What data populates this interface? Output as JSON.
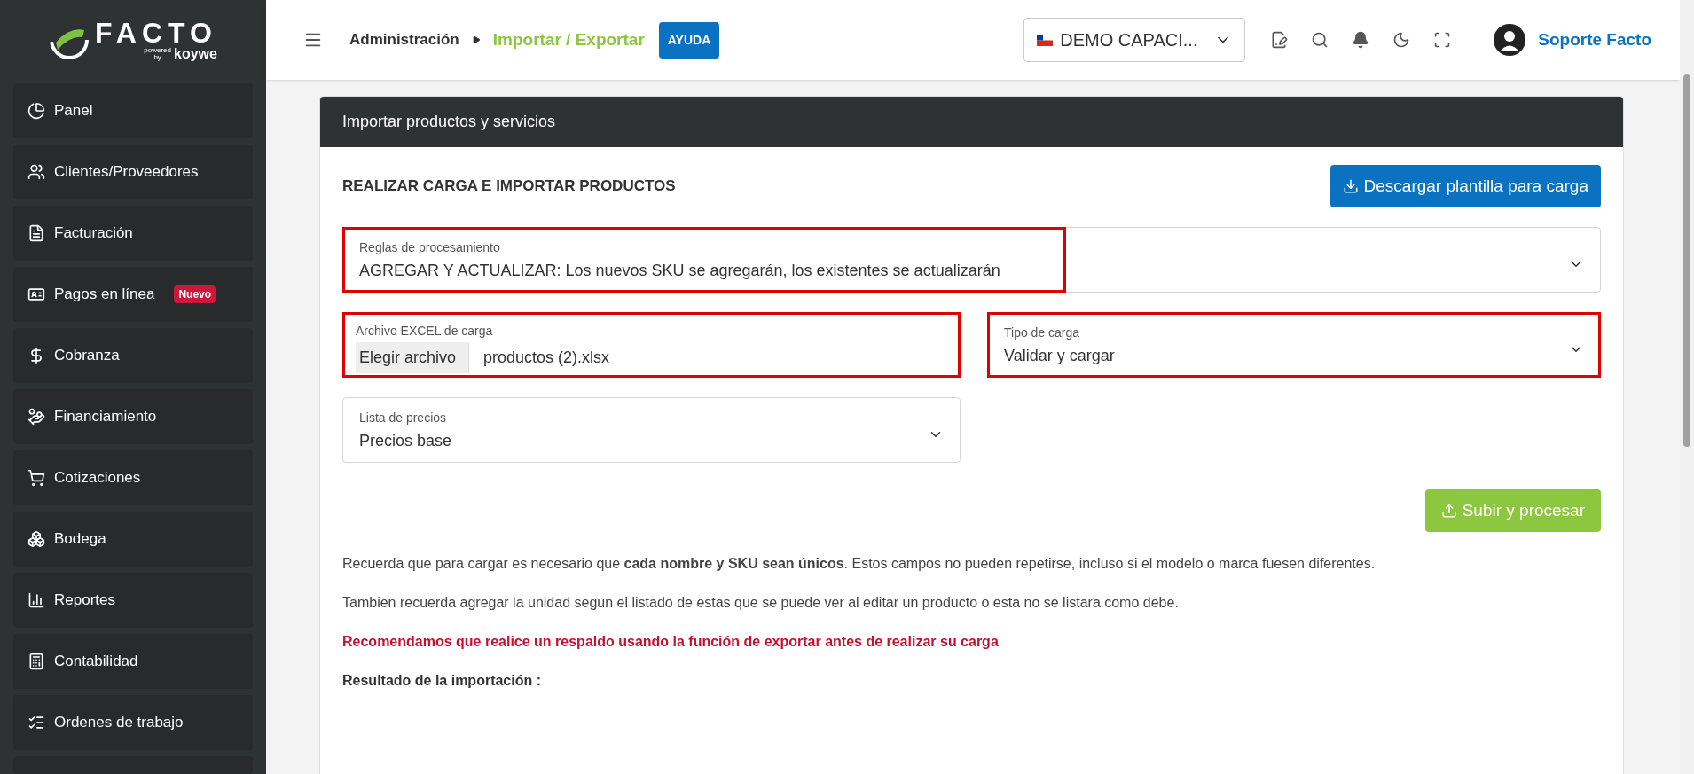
{
  "logo": {
    "name": "FACTO",
    "tagline_1": "powered",
    "tagline_2": "by",
    "tagline_brand": "koywe"
  },
  "sidebar": {
    "items": [
      {
        "label": "Panel"
      },
      {
        "label": "Clientes/Proveedores"
      },
      {
        "label": "Facturación"
      },
      {
        "label": "Pagos en línea",
        "badge": "Nuevo"
      },
      {
        "label": "Cobranza"
      },
      {
        "label": "Financiamiento"
      },
      {
        "label": "Cotizaciones"
      },
      {
        "label": "Bodega"
      },
      {
        "label": "Reportes"
      },
      {
        "label": "Contabilidad"
      },
      {
        "label": "Ordenes de trabajo"
      }
    ]
  },
  "header": {
    "breadcrumb": [
      "Administración",
      "Importar / Exportar"
    ],
    "help": "AYUDA",
    "company": "DEMO CAPACI...",
    "user": "Soporte Facto"
  },
  "card": {
    "title": "Importar productos y servicios",
    "section_title": "REALIZAR CARGA E IMPORTAR PRODUCTOS",
    "download_button": "Descargar plantilla para carga",
    "fields": [
      {
        "kind": "select",
        "label": "Reglas de procesamiento",
        "value": "AGREGAR Y ACTUALIZAR: Los nuevos SKU se agregarán, los existentes se actualizarán",
        "highlighted": true
      },
      {
        "kind": "file",
        "label": "Archivo EXCEL de carga",
        "button": "Elegir archivo",
        "value": "productos (2).xlsx",
        "highlighted": true
      },
      {
        "kind": "select",
        "label": "Tipo de carga",
        "value": "Validar y cargar",
        "highlighted": true
      },
      {
        "kind": "select",
        "label": "Lista de precios",
        "value": "Precios base",
        "highlighted": false
      }
    ],
    "submit_button": "Subir y procesar",
    "notes": [
      {
        "kind": "normal",
        "text": "Recuerda que para cargar es necesario que **cada nombre y SKU sean únicos**. Estos campos no pueden repetirse, incluso si el modelo o marca fuesen diferentes."
      },
      {
        "kind": "normal",
        "text": "Tambien recuerda agregar la unidad segun el listado de estas que se puede ver al editar un producto o esta no se listara como debe."
      },
      {
        "kind": "warning",
        "text": "Recomendamos que realice un respaldo usando la función de exportar antes de realizar su carga"
      },
      {
        "kind": "heading",
        "text": "Resultado de la importación :"
      }
    ]
  }
}
